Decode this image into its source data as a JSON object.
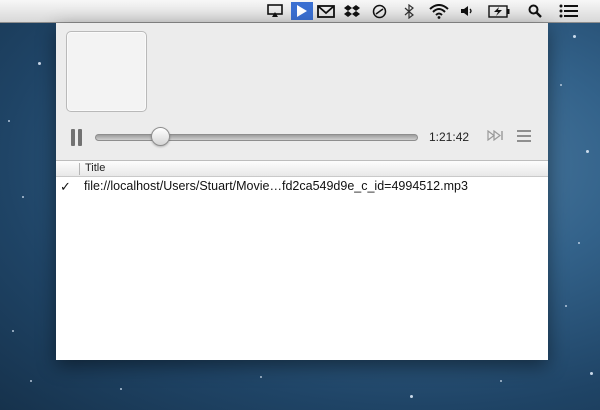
{
  "menubar": {
    "icons": [
      "airplay-icon",
      "play-icon",
      "gmail-icon",
      "dropbox-icon",
      "time-machine-icon",
      "bluetooth-icon",
      "wifi-icon",
      "volume-icon",
      "battery-icon",
      "spotlight-icon",
      "notification-center-icon"
    ]
  },
  "player": {
    "elapsed_time": "1:21:42",
    "progress": 0.2,
    "state": "playing",
    "accent": "#3a6fd1"
  },
  "playlist": {
    "columns": [
      "Title"
    ],
    "rows": [
      {
        "checked": "✓",
        "title": "file://localhost/Users/Stuart/Movie…fd2ca549d9e_c_id=4994512.mp3"
      }
    ]
  }
}
